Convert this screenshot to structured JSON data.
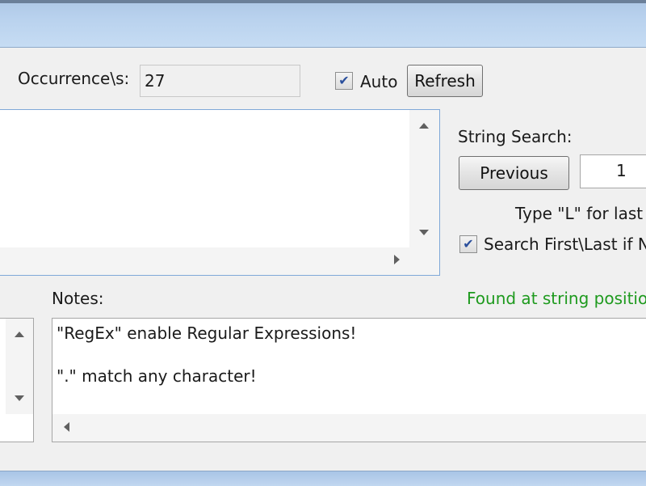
{
  "occurrences": {
    "label": "Occurrence\\s:",
    "value": "27"
  },
  "auto": {
    "label": "Auto",
    "checked": true
  },
  "refresh_button": {
    "label": "Refresh"
  },
  "string_search": {
    "label": "String Search:",
    "previous_label": "Previous",
    "index_value": "1",
    "hint": "Type \"L\" for last o",
    "first_last_label": "Search First\\Last if N",
    "first_last_checked": true
  },
  "notes": {
    "label": "Notes:",
    "lines": [
      "\"RegEx\" enable Regular Expressions!",
      "\".\" match any character!"
    ]
  },
  "status": {
    "text": "Found at string position",
    "color": "#1e9a1e"
  },
  "checkmark_glyph": "✔"
}
